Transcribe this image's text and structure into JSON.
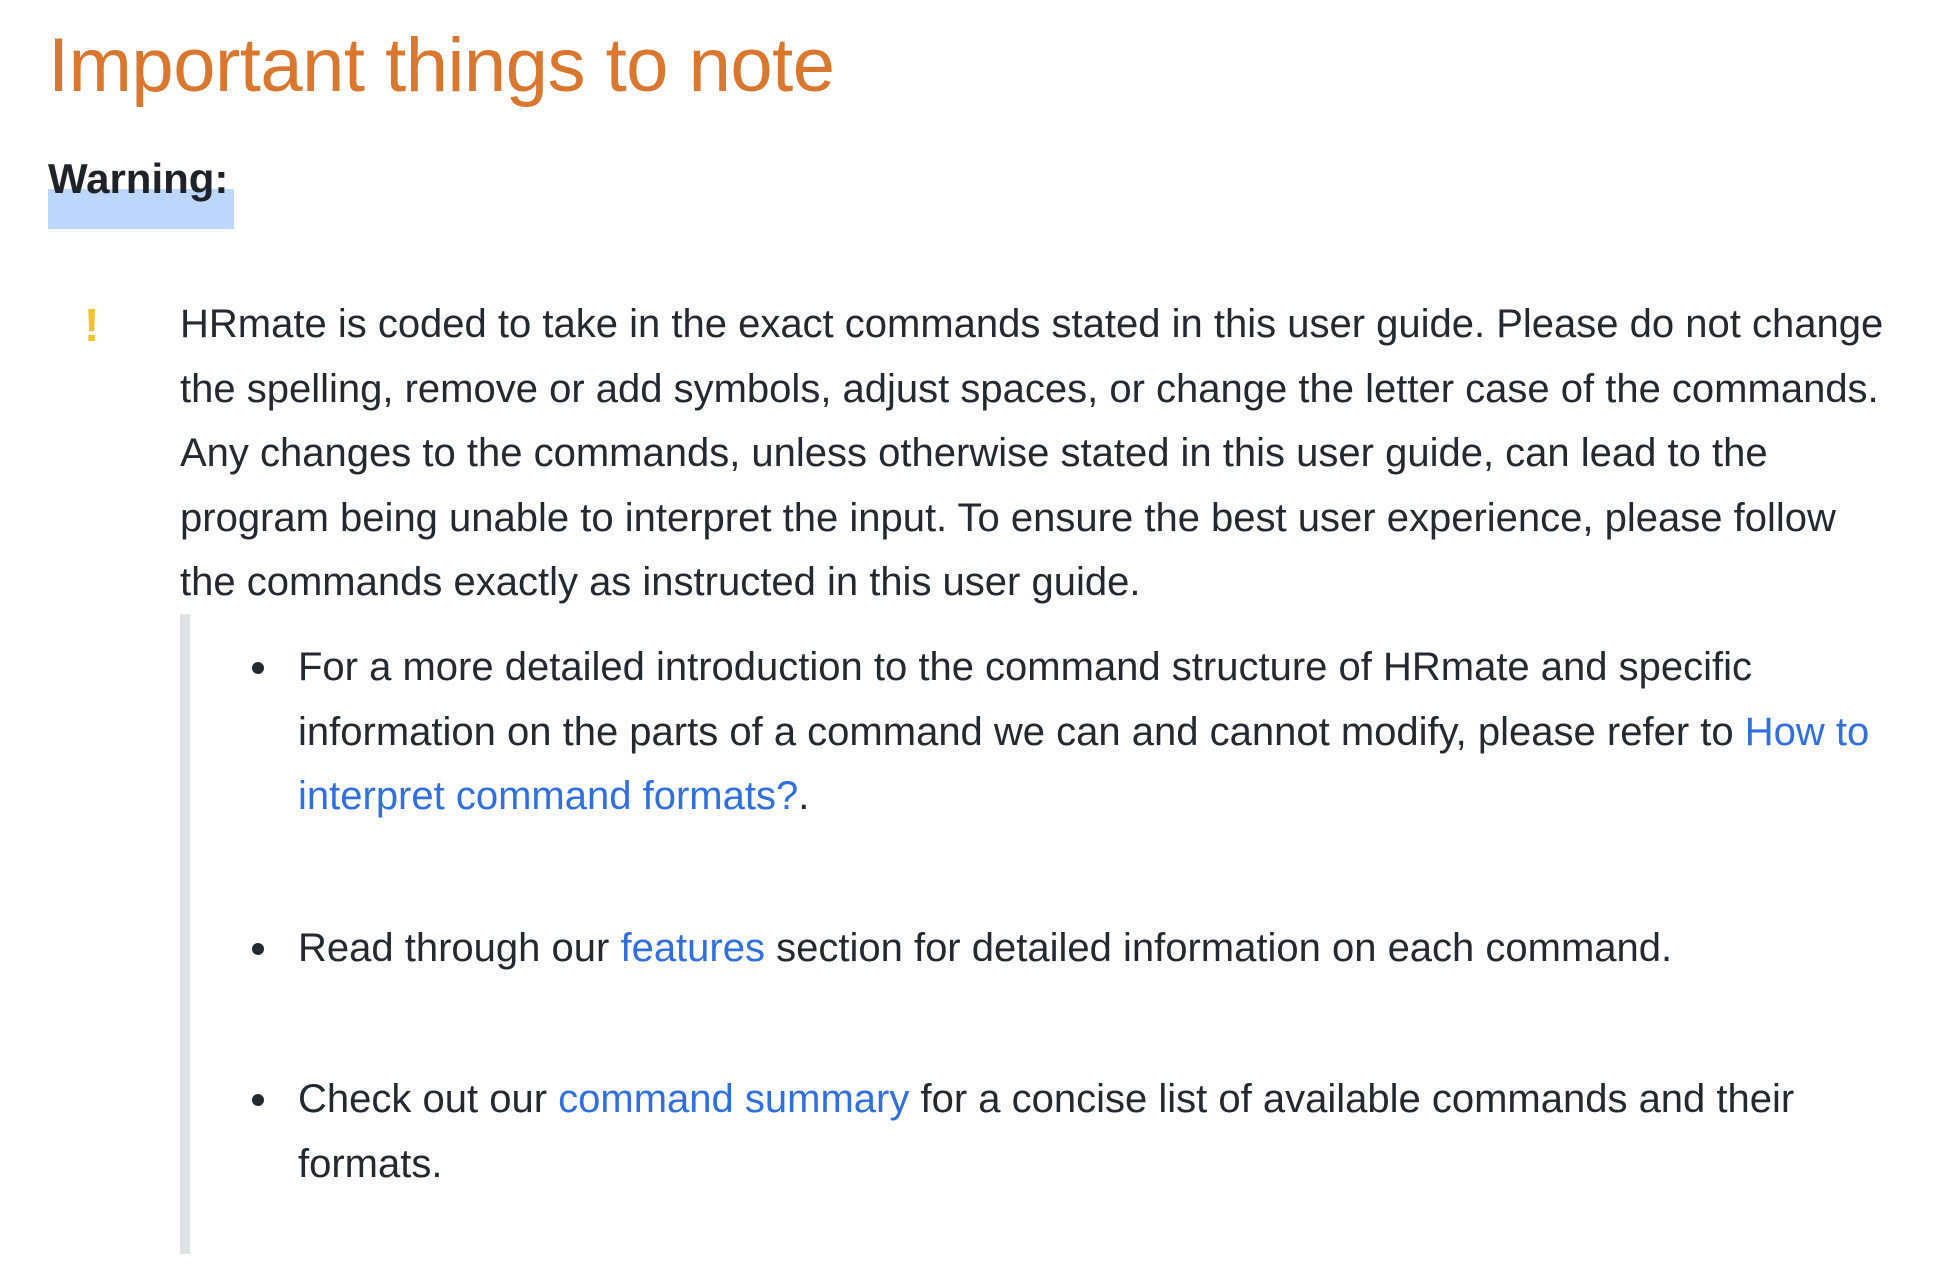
{
  "page": {
    "title": "Important things to note"
  },
  "warning": {
    "label": "Warning:",
    "icon": "exclamation-icon",
    "icon_color": "#f2c12e",
    "body": "HRmate is coded to take in the exact commands stated in this user guide. Please do not change the spelling, remove or add symbols, adjust spaces, or change the letter case of the commands. Any changes to the commands, unless otherwise stated in this user guide, can lead to the program being unable to interpret the input. To ensure the best user experience, please follow the commands exactly as instructed in this user guide."
  },
  "tips": {
    "items": [
      {
        "before": "For a more detailed introduction to the command structure of HRmate and specific information on the parts of a command we can and cannot modify, please refer to ",
        "link": "How to interpret command formats?",
        "after": "."
      },
      {
        "before": "Read through our ",
        "link": "features",
        "after": " section for detailed information on each command."
      },
      {
        "before": "Check out our ",
        "link": "command summary",
        "after": " for a concise list of available commands and their formats."
      }
    ]
  },
  "colors": {
    "heading": "#d9772e",
    "link": "#2f6fe0",
    "highlight": "#bcd7fb",
    "quote_bar": "#dfe2e5",
    "text": "#24292f"
  }
}
